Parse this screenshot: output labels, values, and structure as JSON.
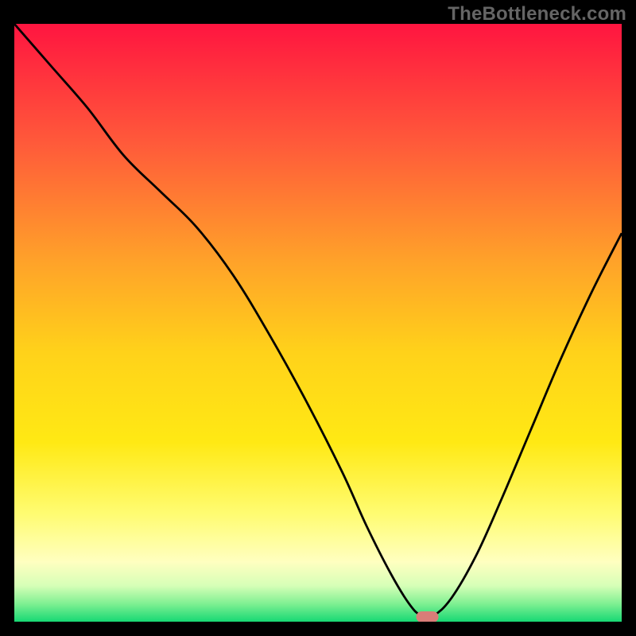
{
  "watermark": "TheBottleneck.com",
  "chart_data": {
    "type": "line",
    "title": "",
    "xlabel": "",
    "ylabel": "",
    "xlim": [
      0,
      100
    ],
    "ylim": [
      0,
      100
    ],
    "series": [
      {
        "name": "bottleneck-curve",
        "x": [
          0,
          6,
          12,
          18,
          24,
          30,
          36,
          42,
          48,
          54,
          58,
          62,
          65,
          67,
          69,
          72,
          76,
          80,
          85,
          90,
          95,
          100
        ],
        "y": [
          100,
          93,
          86,
          78,
          72,
          66,
          58,
          48,
          37,
          25,
          16,
          8,
          3,
          1,
          1,
          4,
          11,
          20,
          32,
          44,
          55,
          65
        ]
      }
    ],
    "marker": {
      "x": 68,
      "y": 0.8,
      "color": "#d97d78"
    },
    "gradient_stops": [
      {
        "offset": 0.0,
        "color": "#ff1540"
      },
      {
        "offset": 0.2,
        "color": "#ff5a3a"
      },
      {
        "offset": 0.4,
        "color": "#ffa329"
      },
      {
        "offset": 0.55,
        "color": "#ffd21a"
      },
      {
        "offset": 0.7,
        "color": "#ffe914"
      },
      {
        "offset": 0.82,
        "color": "#fffc72"
      },
      {
        "offset": 0.9,
        "color": "#ffffc0"
      },
      {
        "offset": 0.94,
        "color": "#d6ffb7"
      },
      {
        "offset": 0.97,
        "color": "#7ff092"
      },
      {
        "offset": 1.0,
        "color": "#17d874"
      }
    ]
  }
}
